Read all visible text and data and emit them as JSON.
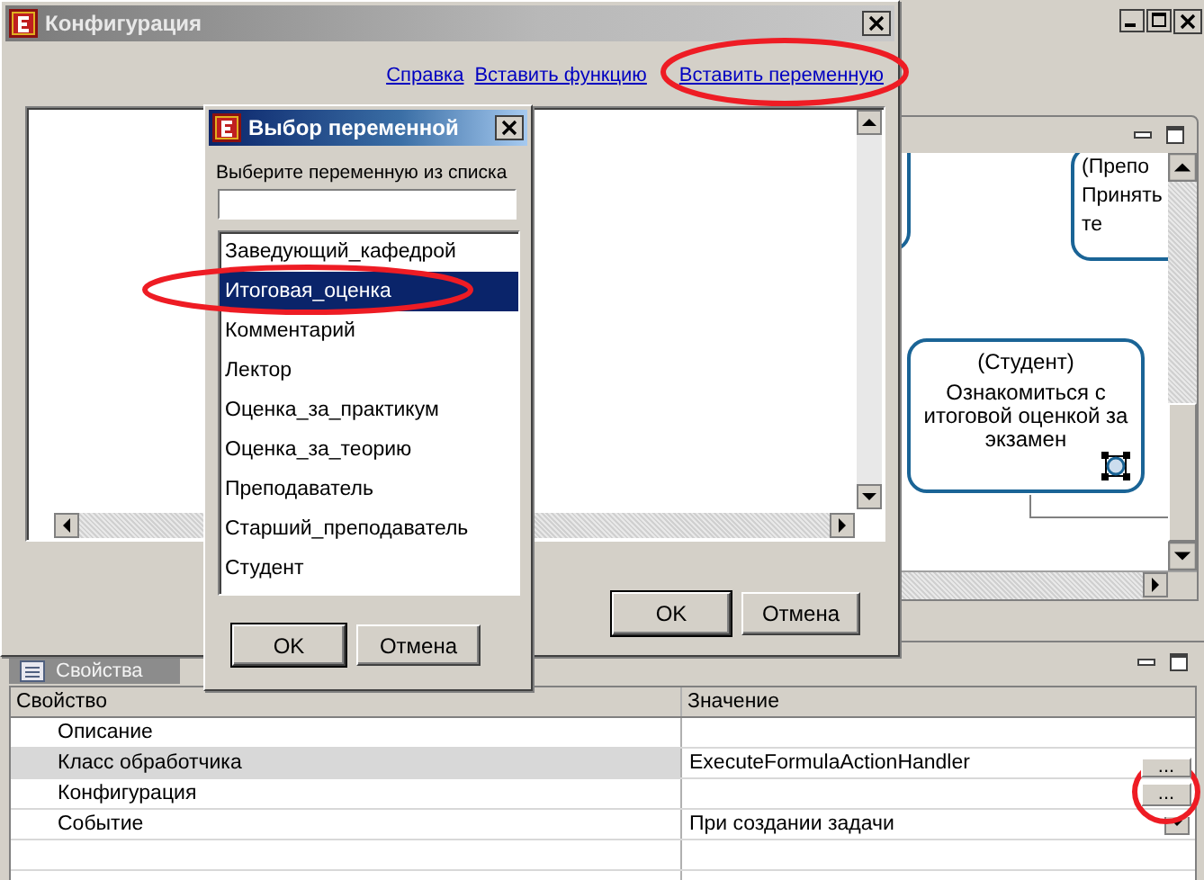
{
  "diagram": {
    "nodes": [
      {
        "kind": "edge"
      },
      {
        "kind": "partial",
        "lines": [
          "(Препо",
          "Принять",
          "те"
        ]
      },
      {
        "kind": "task",
        "lines": [
          "(Студент)",
          "Ознакомиться с",
          "итоговой оценкой за",
          "экзамен"
        ]
      }
    ]
  },
  "properties": {
    "tab": "Свойства",
    "columns": [
      "Свойство",
      "Значение"
    ],
    "rows": [
      {
        "kind": "text",
        "property": "Описание",
        "selected": false
      },
      {
        "kind": "ellipsis",
        "property": "Класс обработчика",
        "value": "ExecuteFormulaActionHandler",
        "selected": true,
        "button": "..."
      },
      {
        "kind": "ellipsis",
        "property": "Конфигурация",
        "selected": false,
        "button": "..."
      },
      {
        "kind": "dropdown",
        "property": "Событие",
        "value": "При создании задачи",
        "selected": false
      },
      {
        "kind": "text",
        "selected": false
      },
      {
        "kind": "text",
        "selected": false
      }
    ]
  },
  "config_dialog": {
    "title": "Конфигурация",
    "links": [
      "Справка",
      "Вставить функцию",
      "Вставить переменную"
    ],
    "buttons": [
      "OK",
      "Отмена"
    ]
  },
  "variable_dialog": {
    "title": "Выбор переменной",
    "prompt": "Выберите переменную из списка",
    "items": [
      {
        "label": "Заведующий_кафедрой",
        "selected": false
      },
      {
        "label": "Итоговая_оценка",
        "selected": true
      },
      {
        "label": "Комментарий",
        "selected": false
      },
      {
        "label": "Лектор",
        "selected": false
      },
      {
        "label": "Оценка_за_практикум",
        "selected": false
      },
      {
        "label": "Оценка_за_теорию",
        "selected": false
      },
      {
        "label": "Преподаватель",
        "selected": false
      },
      {
        "label": "Старший_преподаватель",
        "selected": false
      },
      {
        "label": "Студент",
        "selected": false
      }
    ],
    "buttons": [
      "OK",
      "Отмена"
    ]
  }
}
